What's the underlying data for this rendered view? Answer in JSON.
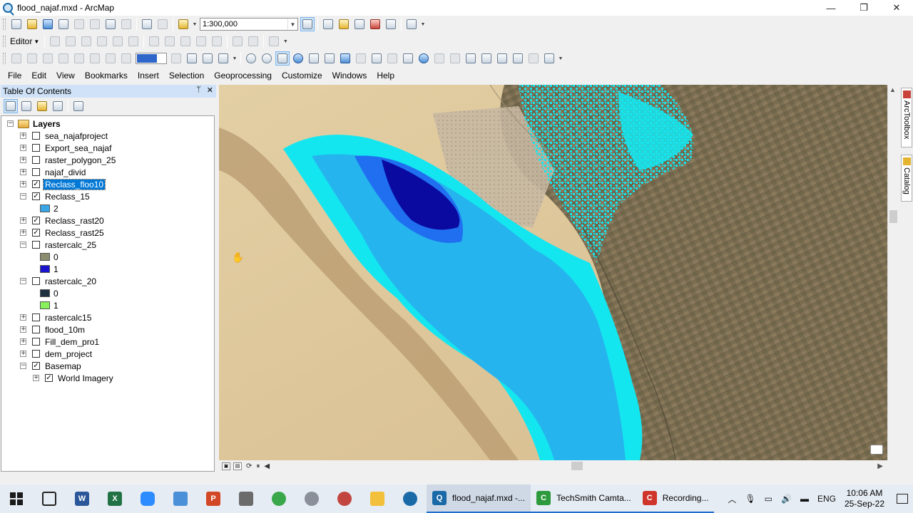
{
  "window": {
    "title": "flood_najaf.mxd - ArcMap",
    "minimize": "—",
    "maximize": "❐",
    "close": "✕"
  },
  "toolbar": {
    "map_scale": "1:300,000",
    "editor_label": "Editor",
    "icons_row1": [
      "new-doc-icon",
      "open-folder-icon",
      "save-icon",
      "print-icon",
      "cut-icon",
      "copy-icon",
      "paste-icon",
      "delete-icon",
      "undo-icon",
      "redo-icon",
      "add-data-icon",
      "scale-icon",
      "editor-toolbar-icon",
      "arctoolbox-icon",
      "catalog-icon",
      "model-builder-icon",
      "python-icon",
      "search-window-icon"
    ],
    "icons_row3": [
      "zoom-in-icon",
      "zoom-out-icon",
      "pan-icon",
      "full-extent-icon",
      "fixed-zoom-in-icon",
      "fixed-zoom-out-icon",
      "back-icon",
      "forward-icon",
      "select-features-icon",
      "clear-selection-icon",
      "select-elements-icon",
      "identify-icon",
      "hyperlink-icon",
      "html-popup-icon",
      "measure-icon",
      "find-icon",
      "find-route-icon",
      "xy-icon",
      "time-slider-icon",
      "create-viewer-icon"
    ]
  },
  "menubar": [
    "File",
    "Edit",
    "View",
    "Bookmarks",
    "Insert",
    "Selection",
    "Geoprocessing",
    "Customize",
    "Windows",
    "Help"
  ],
  "toc": {
    "title": "Table Of Contents",
    "pin": "ᛘ",
    "close": "✕",
    "root": "Layers",
    "rows": [
      {
        "label": "sea_najafproject",
        "checked": false,
        "expander": "+"
      },
      {
        "label": "Export_sea_najaf",
        "checked": false,
        "expander": "+"
      },
      {
        "label": "raster_polygon_25",
        "checked": false,
        "expander": "+"
      },
      {
        "label": "najaf_divid",
        "checked": false,
        "expander": "+"
      },
      {
        "label": "Reclass_floo10",
        "checked": true,
        "expander": "+",
        "selected": true
      },
      {
        "label": "Reclass_15",
        "checked": true,
        "expander": "−"
      },
      {
        "legend": "2",
        "color": "#39a6e8"
      },
      {
        "label": "Reclass_rast20",
        "checked": true,
        "expander": "+"
      },
      {
        "label": "Reclass_rast25",
        "checked": true,
        "expander": "+"
      },
      {
        "label": "rastercalc_25",
        "checked": false,
        "expander": "−"
      },
      {
        "legend": "0",
        "color": "#8c8c6e"
      },
      {
        "legend": "1",
        "color": "#1a14cc"
      },
      {
        "label": "rastercalc_20",
        "checked": false,
        "expander": "−"
      },
      {
        "legend": "0",
        "color": "#1c3040"
      },
      {
        "legend": "1",
        "color": "#88f05a"
      },
      {
        "label": "rastercalc15",
        "checked": false,
        "expander": "+"
      },
      {
        "label": "flood_10m",
        "checked": false,
        "expander": "+"
      },
      {
        "label": "Fill_dem_pro1",
        "checked": false,
        "expander": "+"
      },
      {
        "label": "dem_project",
        "checked": false,
        "expander": "+"
      },
      {
        "label": "Basemap",
        "checked": true,
        "expander": "−"
      },
      {
        "label": "World Imagery",
        "checked": true,
        "expander": "+",
        "indent": true
      }
    ]
  },
  "side_tabs": {
    "arctoolbox": "ArcToolbox",
    "catalog": "Catalog"
  },
  "taskbar": {
    "pinned": [
      "start-icon",
      "task-view-icon",
      "word-icon",
      "excel-icon",
      "zoom-icon",
      "store-icon",
      "powerpoint-icon",
      "calculator-icon",
      "app-icon",
      "app2-icon",
      "app3-icon",
      "file-explorer-icon",
      "arcgis-icon"
    ],
    "apps": [
      {
        "label": "flood_najaf.mxd -...",
        "active": true,
        "color": "#1b6aa8",
        "glyph": "Q"
      },
      {
        "label": "TechSmith Camta...",
        "active": false,
        "color": "#2e9a3e",
        "glyph": "C"
      },
      {
        "label": "Recording...",
        "active": false,
        "color": "#d0352b",
        "glyph": "C"
      }
    ],
    "tray": {
      "chevron": "︿",
      "lang": "ENG",
      "time": "10:06 AM",
      "date": "25-Sep-22"
    }
  },
  "colors": {
    "flood_light": "#14e6f0",
    "flood_mid": "#26b4ee",
    "flood_dark": "#1f6ff0",
    "flood_deep": "#0a0aa0"
  }
}
